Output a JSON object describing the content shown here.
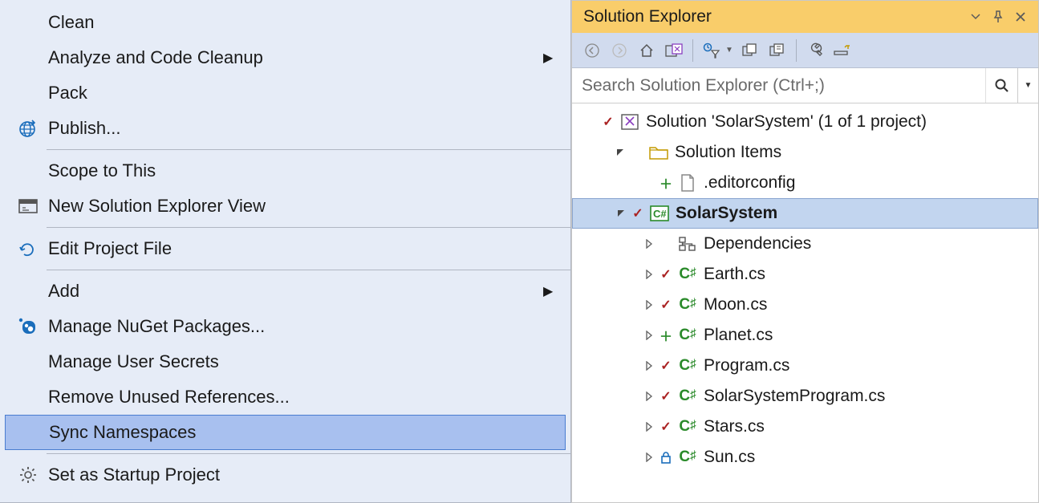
{
  "context_menu": {
    "items": [
      {
        "label": "Clean",
        "icon": "",
        "arrow": false
      },
      {
        "label": "Analyze and Code Cleanup",
        "icon": "",
        "arrow": true
      },
      {
        "label": "Pack",
        "icon": "",
        "arrow": false
      },
      {
        "label": "Publish...",
        "icon": "globe",
        "arrow": false
      },
      {
        "sep": true
      },
      {
        "label": "Scope to This",
        "icon": "",
        "arrow": false
      },
      {
        "label": "New Solution Explorer View",
        "icon": "window",
        "arrow": false
      },
      {
        "sep": true
      },
      {
        "label": "Edit Project File",
        "icon": "redo",
        "arrow": false
      },
      {
        "sep": true
      },
      {
        "label": "Add",
        "icon": "",
        "arrow": true
      },
      {
        "label": "Manage NuGet Packages...",
        "icon": "nuget",
        "arrow": false
      },
      {
        "label": "Manage User Secrets",
        "icon": "",
        "arrow": false
      },
      {
        "label": "Remove Unused References...",
        "icon": "",
        "arrow": false
      },
      {
        "label": "Sync Namespaces",
        "icon": "",
        "arrow": false,
        "highlighted": true
      },
      {
        "sep": true
      },
      {
        "label": "Set as Startup Project",
        "icon": "gear",
        "arrow": false
      }
    ]
  },
  "explorer": {
    "title": "Solution Explorer",
    "search_placeholder": "Search Solution Explorer (Ctrl+;)",
    "tree": [
      {
        "indent": 0,
        "expander": "none",
        "status": "check",
        "icon": "solution",
        "label": "Solution 'SolarSystem' (1 of 1 project)",
        "bold": false
      },
      {
        "indent": 1,
        "expander": "open",
        "status": "",
        "icon": "folder",
        "label": "Solution Items",
        "bold": false
      },
      {
        "indent": 2,
        "expander": "none",
        "status": "plus",
        "icon": "file",
        "label": ".editorconfig",
        "bold": false
      },
      {
        "indent": 1,
        "expander": "open",
        "status": "check",
        "icon": "csproj",
        "label": "SolarSystem",
        "bold": true,
        "selected": true
      },
      {
        "indent": 2,
        "expander": "closed",
        "status": "",
        "icon": "deps",
        "label": "Dependencies",
        "bold": false
      },
      {
        "indent": 2,
        "expander": "closed",
        "status": "check",
        "icon": "cs",
        "label": "Earth.cs",
        "bold": false
      },
      {
        "indent": 2,
        "expander": "closed",
        "status": "check",
        "icon": "cs",
        "label": "Moon.cs",
        "bold": false
      },
      {
        "indent": 2,
        "expander": "closed",
        "status": "plus",
        "icon": "cs",
        "label": "Planet.cs",
        "bold": false
      },
      {
        "indent": 2,
        "expander": "closed",
        "status": "check",
        "icon": "cs",
        "label": "Program.cs",
        "bold": false
      },
      {
        "indent": 2,
        "expander": "closed",
        "status": "check",
        "icon": "cs",
        "label": "SolarSystemProgram.cs",
        "bold": false
      },
      {
        "indent": 2,
        "expander": "closed",
        "status": "check",
        "icon": "cs",
        "label": "Stars.cs",
        "bold": false
      },
      {
        "indent": 2,
        "expander": "closed",
        "status": "lock",
        "icon": "cs",
        "label": "Sun.cs",
        "bold": false
      }
    ]
  }
}
